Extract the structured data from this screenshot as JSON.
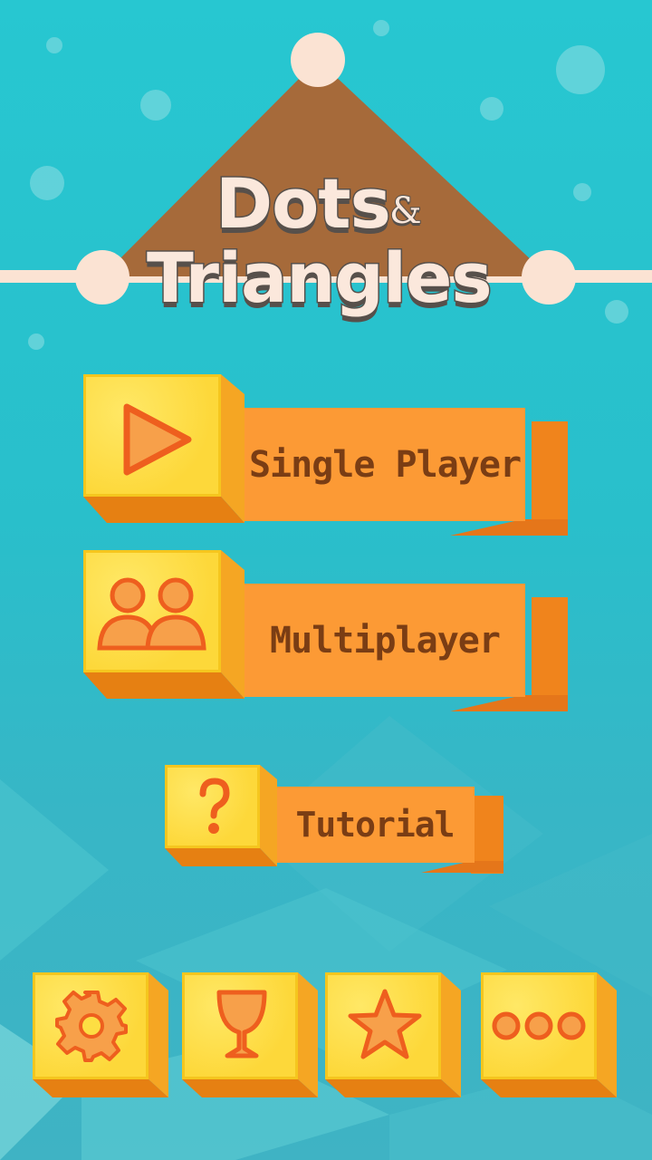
{
  "app": {
    "title_line1": "Dots",
    "title_amp": "&",
    "title_line2": "Triangles"
  },
  "menu": {
    "single_player_label": "Single Player",
    "multiplayer_label": "Multiplayer",
    "tutorial_label": "Tutorial"
  },
  "toolbar": {
    "items": [
      {
        "icon": "gear-icon"
      },
      {
        "icon": "trophy-cup-icon"
      },
      {
        "icon": "star-icon"
      },
      {
        "icon": "more-dots-icon"
      }
    ]
  },
  "colors": {
    "background": "#27c7d1",
    "triangle": "#a66a3a",
    "dot": "#fbe3d3",
    "banner": "#fc9a35",
    "cube": "#fdde43",
    "icon": "#f0691e",
    "label_text": "#7a3d14"
  }
}
